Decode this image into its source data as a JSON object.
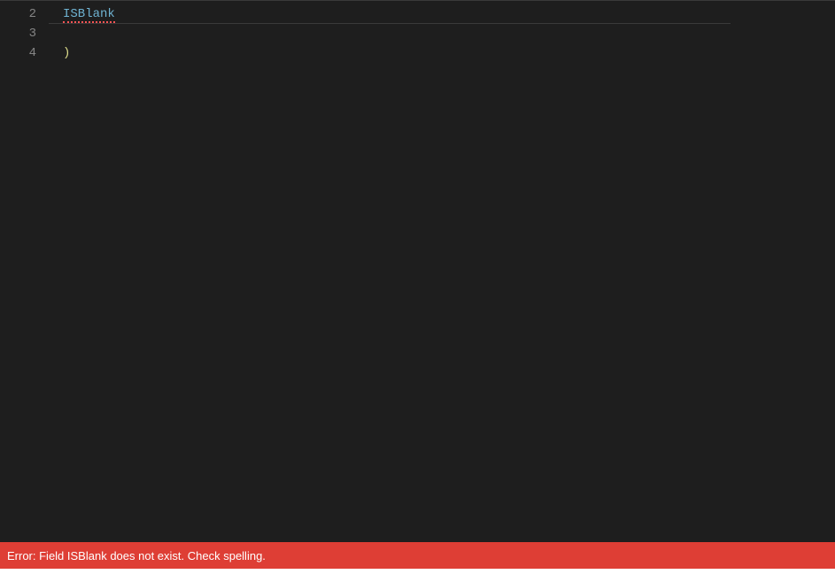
{
  "editor": {
    "lines": [
      {
        "number": "2",
        "tokens": [
          {
            "text": "ISBlank",
            "class": "token-identifier error-squiggle"
          }
        ],
        "highlighted": true
      },
      {
        "number": "3",
        "tokens": []
      },
      {
        "number": "4",
        "tokens": [
          {
            "text": ")",
            "class": "token-paren"
          }
        ]
      }
    ]
  },
  "error": {
    "message": "Error: Field ISBlank does not exist. Check spelling."
  }
}
